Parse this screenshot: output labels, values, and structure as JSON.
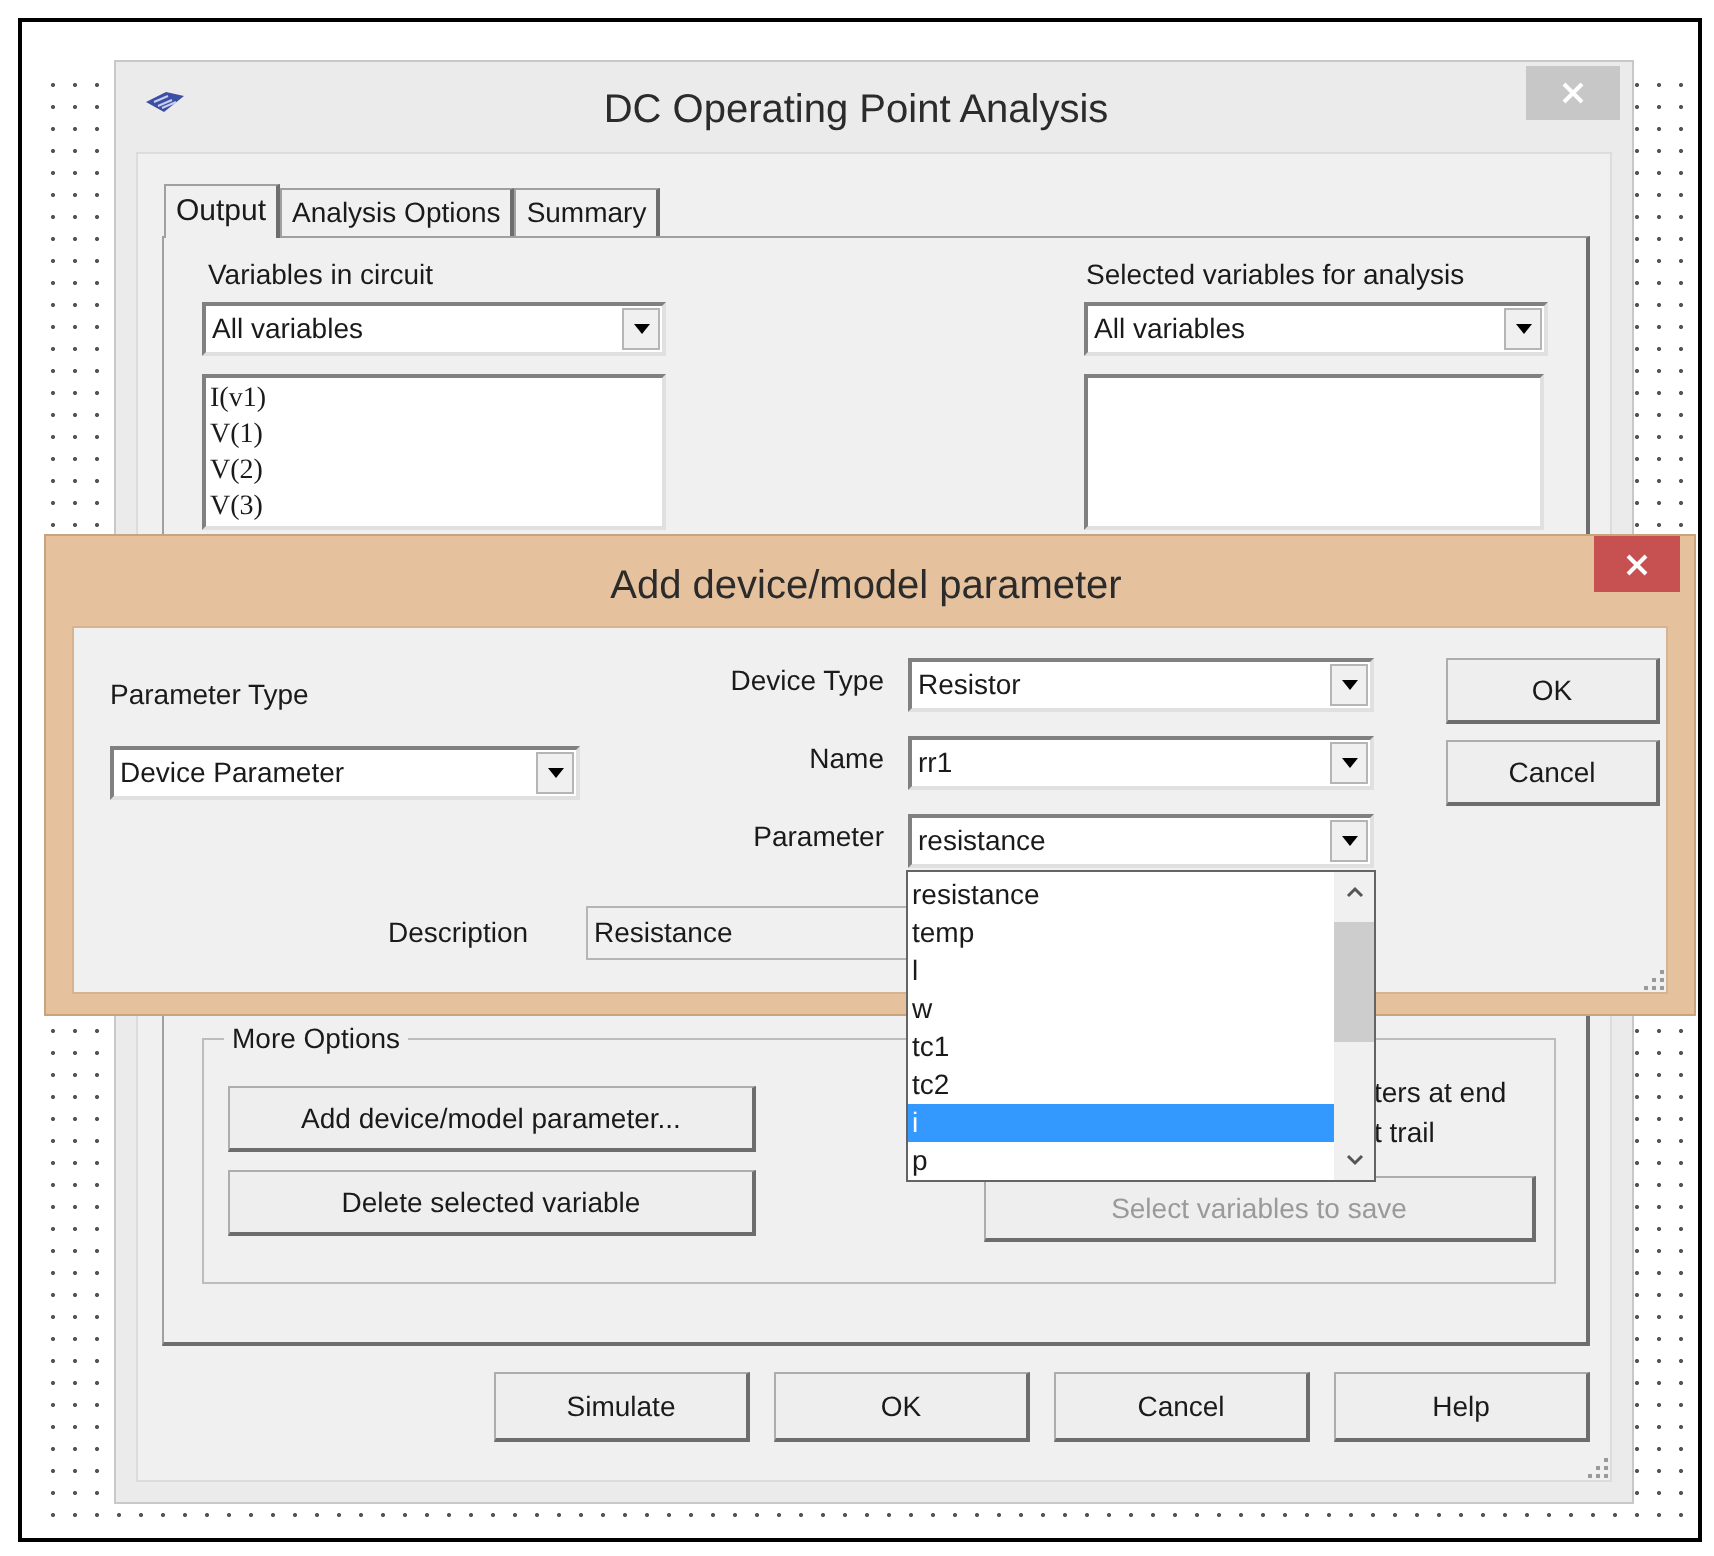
{
  "main_window": {
    "title": "DC Operating Point Analysis",
    "tabs": [
      {
        "label": "Output",
        "selected": true
      },
      {
        "label": "Analysis Options",
        "selected": false
      },
      {
        "label": "Summary",
        "selected": false
      }
    ],
    "variables_in_circuit": {
      "label": "Variables in circuit",
      "filter": "All variables",
      "items": [
        "I(v1)",
        "V(1)",
        "V(2)",
        "V(3)"
      ]
    },
    "selected_variables": {
      "label": "Selected variables for analysis",
      "filter": "All variables"
    },
    "more_options": {
      "title": "More Options",
      "buttons": [
        {
          "label": "Add device/model parameter...",
          "disabled": false
        },
        {
          "label": "Delete selected variable",
          "disabled": false
        },
        {
          "label": "Select variables to save",
          "disabled": true
        }
      ],
      "partial_texts": [
        "ters at end",
        "t trail"
      ]
    },
    "buttons": [
      "Simulate",
      "OK",
      "Cancel",
      "Help"
    ]
  },
  "dialog": {
    "title": "Add device/model parameter",
    "parameter_type": {
      "label": "Parameter Type",
      "value": "Device Parameter"
    },
    "fields": [
      {
        "label": "Device Type",
        "value": "Resistor"
      },
      {
        "label": "Name",
        "value": "rr1"
      },
      {
        "label": "Parameter",
        "value": "resistance"
      }
    ],
    "buttons": [
      "OK",
      "Cancel"
    ],
    "description": {
      "label": "Description",
      "value": "Resistance"
    },
    "dropdown_list": [
      {
        "label": "resistance",
        "selected": false
      },
      {
        "label": "temp",
        "selected": false
      },
      {
        "label": "l",
        "selected": false
      },
      {
        "label": "w",
        "selected": false
      },
      {
        "label": "tc1",
        "selected": false
      },
      {
        "label": "tc2",
        "selected": false
      },
      {
        "label": "i",
        "selected": true
      },
      {
        "label": "p",
        "selected": false
      }
    ]
  }
}
